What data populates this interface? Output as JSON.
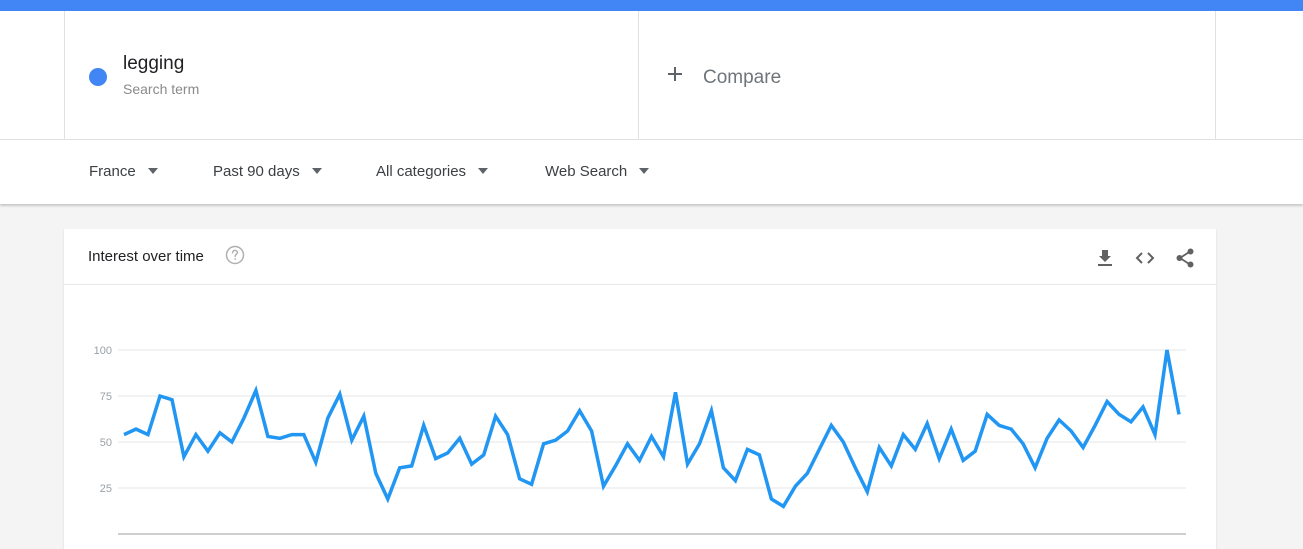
{
  "search": {
    "term": "legging",
    "term_sub": "Search term",
    "term_color": "#4285f4",
    "compare_label": "Compare"
  },
  "filters": [
    {
      "label": "France"
    },
    {
      "label": "Past 90 days"
    },
    {
      "label": "All categories"
    },
    {
      "label": "Web Search"
    }
  ],
  "card": {
    "title": "Interest over time",
    "tools": [
      "download-icon",
      "embed-icon",
      "share-icon"
    ]
  },
  "chart_data": {
    "type": "line",
    "title": "",
    "xlabel": "",
    "ylabel": "",
    "ylim": [
      0,
      100
    ],
    "yticks": [
      25,
      50,
      75,
      100
    ],
    "grid": true,
    "series": [
      {
        "color": "#2196f3",
        "values": [
          54,
          57,
          54,
          75,
          73,
          42,
          54,
          45,
          55,
          50,
          63,
          78,
          53,
          52,
          54,
          54,
          39,
          63,
          76,
          51,
          64,
          33,
          19,
          36,
          37,
          59,
          41,
          44,
          52,
          38,
          43,
          64,
          54,
          30,
          27,
          49,
          51,
          56,
          67,
          56,
          26,
          37,
          49,
          40,
          53,
          42,
          77,
          38,
          49,
          67,
          36,
          29,
          46,
          43,
          19,
          15,
          26,
          33,
          46,
          59,
          50,
          36,
          23,
          47,
          37,
          54,
          46,
          60,
          41,
          57,
          40,
          45,
          65,
          59,
          57,
          49,
          36,
          52,
          62,
          56,
          47,
          59,
          72,
          65,
          61,
          69,
          54,
          100,
          65
        ]
      }
    ]
  }
}
